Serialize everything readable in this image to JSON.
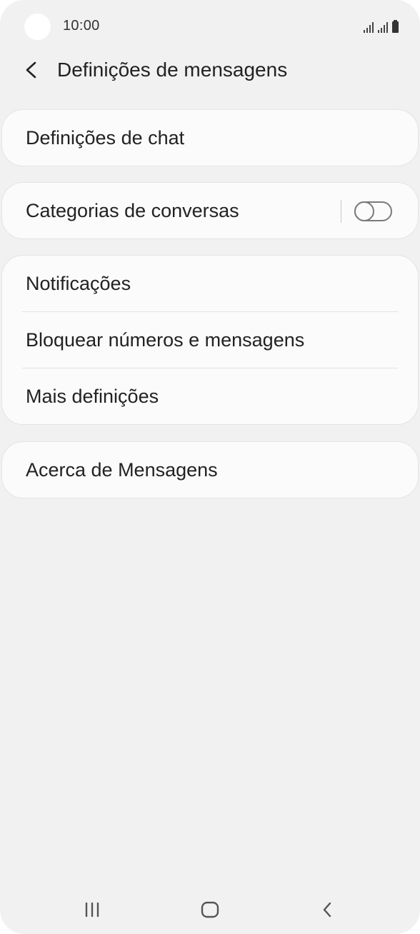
{
  "status_bar": {
    "time": "10:00",
    "icons": [
      "signal-icon",
      "signal-icon",
      "battery-icon"
    ]
  },
  "header": {
    "back_icon": "chevron-left-icon",
    "title": "Definições de mensagens"
  },
  "settings": {
    "chat_settings": "Definições de chat",
    "conversation_categories": {
      "label": "Categorias de conversas",
      "toggle_on": false
    },
    "group": [
      {
        "label": "Notificações"
      },
      {
        "label": "Bloquear números e mensagens"
      },
      {
        "label": "Mais definições"
      }
    ],
    "about": "Acerca de Mensagens"
  },
  "nav_bar": {
    "icons": [
      "recent-apps-icon",
      "home-icon",
      "back-icon"
    ]
  },
  "colors": {
    "background": "#f1f1f1",
    "card": "#fbfbfb",
    "text": "#222222"
  }
}
